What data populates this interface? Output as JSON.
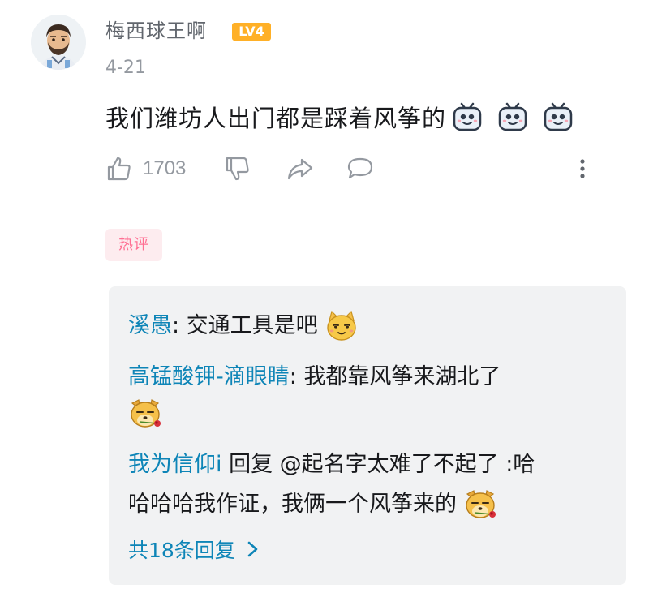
{
  "comment": {
    "username": "梅西球王啊",
    "level": "LV4",
    "date": "4-21",
    "text": "我们潍坊人出门都是踩着风筝的",
    "emojis": [
      "tv-smile-icon",
      "tv-smile-icon",
      "tv-smile-icon"
    ],
    "like_count": "1703"
  },
  "hot_badge": "热评",
  "replies": [
    {
      "user": "溪愚",
      "separator": ": ",
      "text": "交通工具是吧",
      "emoji": "cat-smug-icon"
    },
    {
      "user": "高锰酸钾-滴眼睛",
      "separator": ": ",
      "text": "我都靠风筝来湖北了",
      "emoji": "dog-rose-icon"
    },
    {
      "user": "我为信仰i",
      "text_line1": " 回复 @起名字太难了不起了 :哈",
      "text_line2": "哈哈哈我作证，我俩一个风筝来的",
      "emoji": "dog-rose-icon"
    }
  ],
  "more_replies": "共18条回复",
  "colors": {
    "username": "#61666d",
    "level_badge": "#ffb027",
    "link_blue": "#0e85b7",
    "hot_badge_bg": "#fdecef",
    "hot_badge_text": "#ff6f93",
    "reply_box_bg": "#f1f2f3"
  }
}
